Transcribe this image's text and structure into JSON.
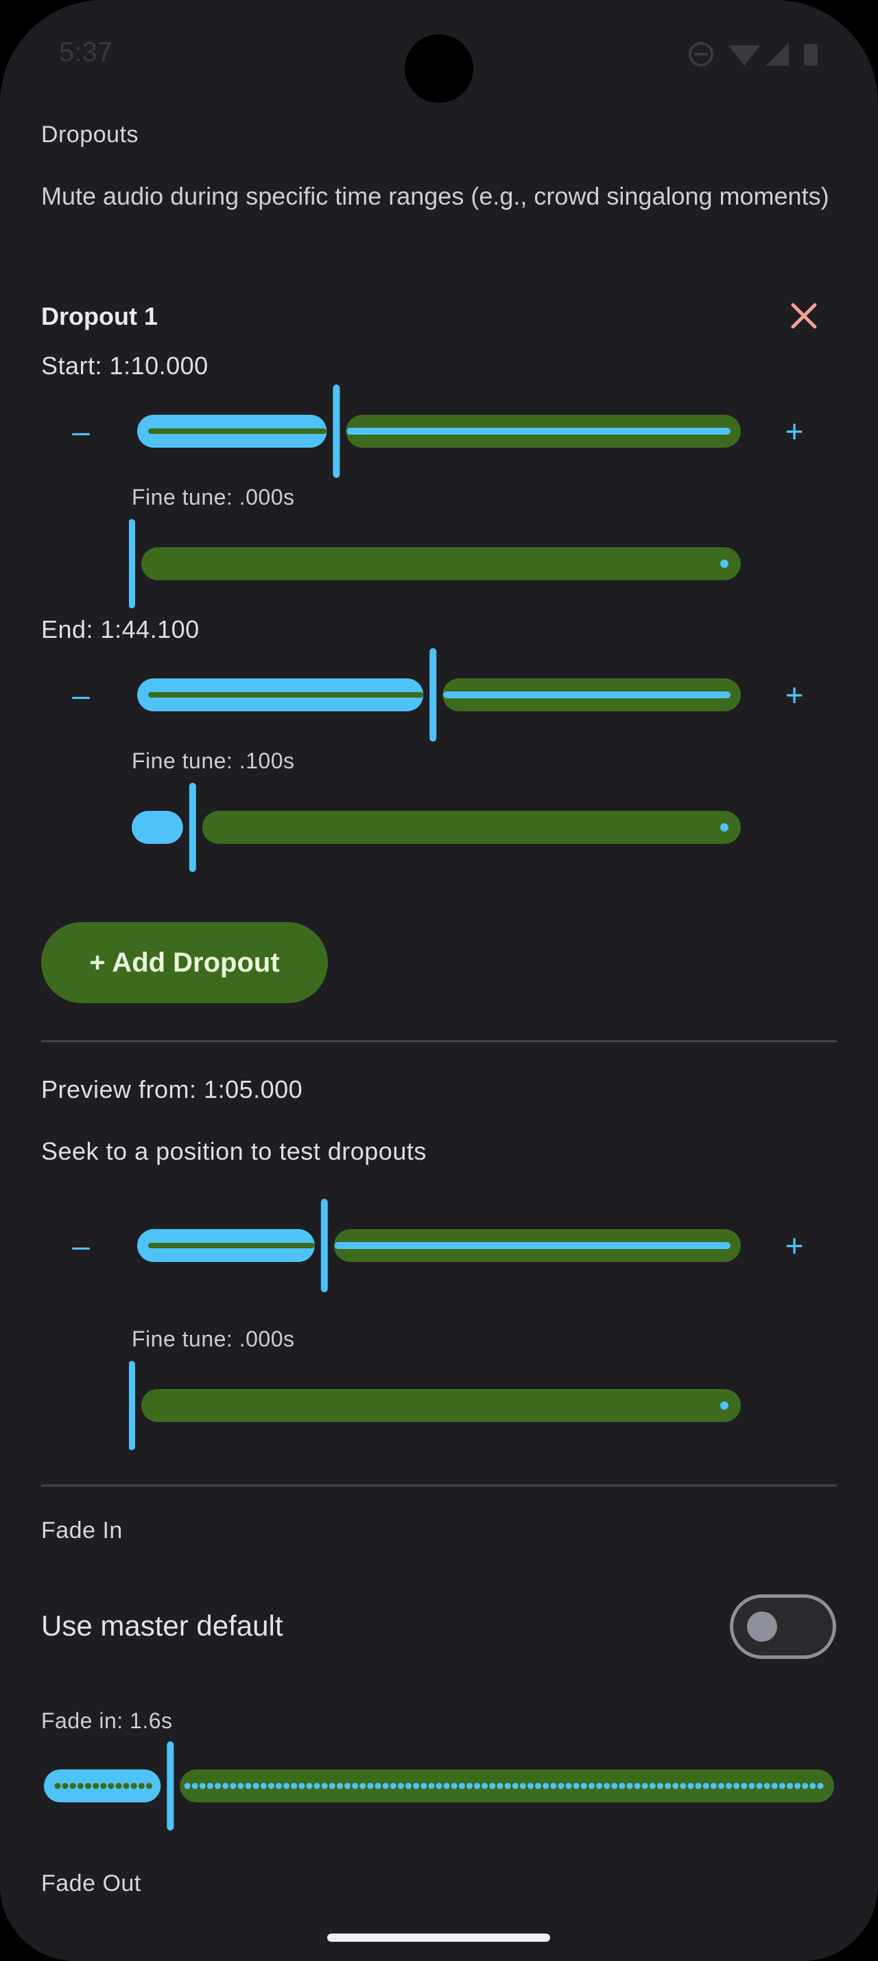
{
  "status_bar": {
    "time": "5:37"
  },
  "dropouts": {
    "title": "Dropouts",
    "description": "Mute audio during specific time ranges (e.g., crowd singalong moments)",
    "items": [
      {
        "title": "Dropout 1",
        "start_label": "Start: 1:10.000",
        "start_coarse_fraction": 0.33,
        "start_fine_label": "Fine tune: .000s",
        "start_fine_fraction": 0.0,
        "end_label": "End: 1:44.100",
        "end_coarse_fraction": 0.49,
        "end_fine_label": "Fine tune: .100s",
        "end_fine_fraction": 0.1
      }
    ],
    "add_button": "+ Add Dropout"
  },
  "preview": {
    "label": "Preview from:  1:05.000",
    "hint": "Seek to a position to test dropouts",
    "coarse_fraction": 0.31,
    "fine_label": "Fine tune: .000s",
    "fine_fraction": 0.0
  },
  "fade_in": {
    "title": "Fade In",
    "master_label": "Use master default",
    "master_on": false,
    "value_label": "Fade in: 1.6s",
    "value_fraction": 0.16
  },
  "fade_out": {
    "title": "Fade Out"
  },
  "controls": {
    "minus": "–",
    "plus": "+"
  },
  "colors": {
    "background": "#1E1D22",
    "accent_blue": "#4FC3F7",
    "track_green": "#3D6B1E",
    "close_red": "#F2A193"
  }
}
